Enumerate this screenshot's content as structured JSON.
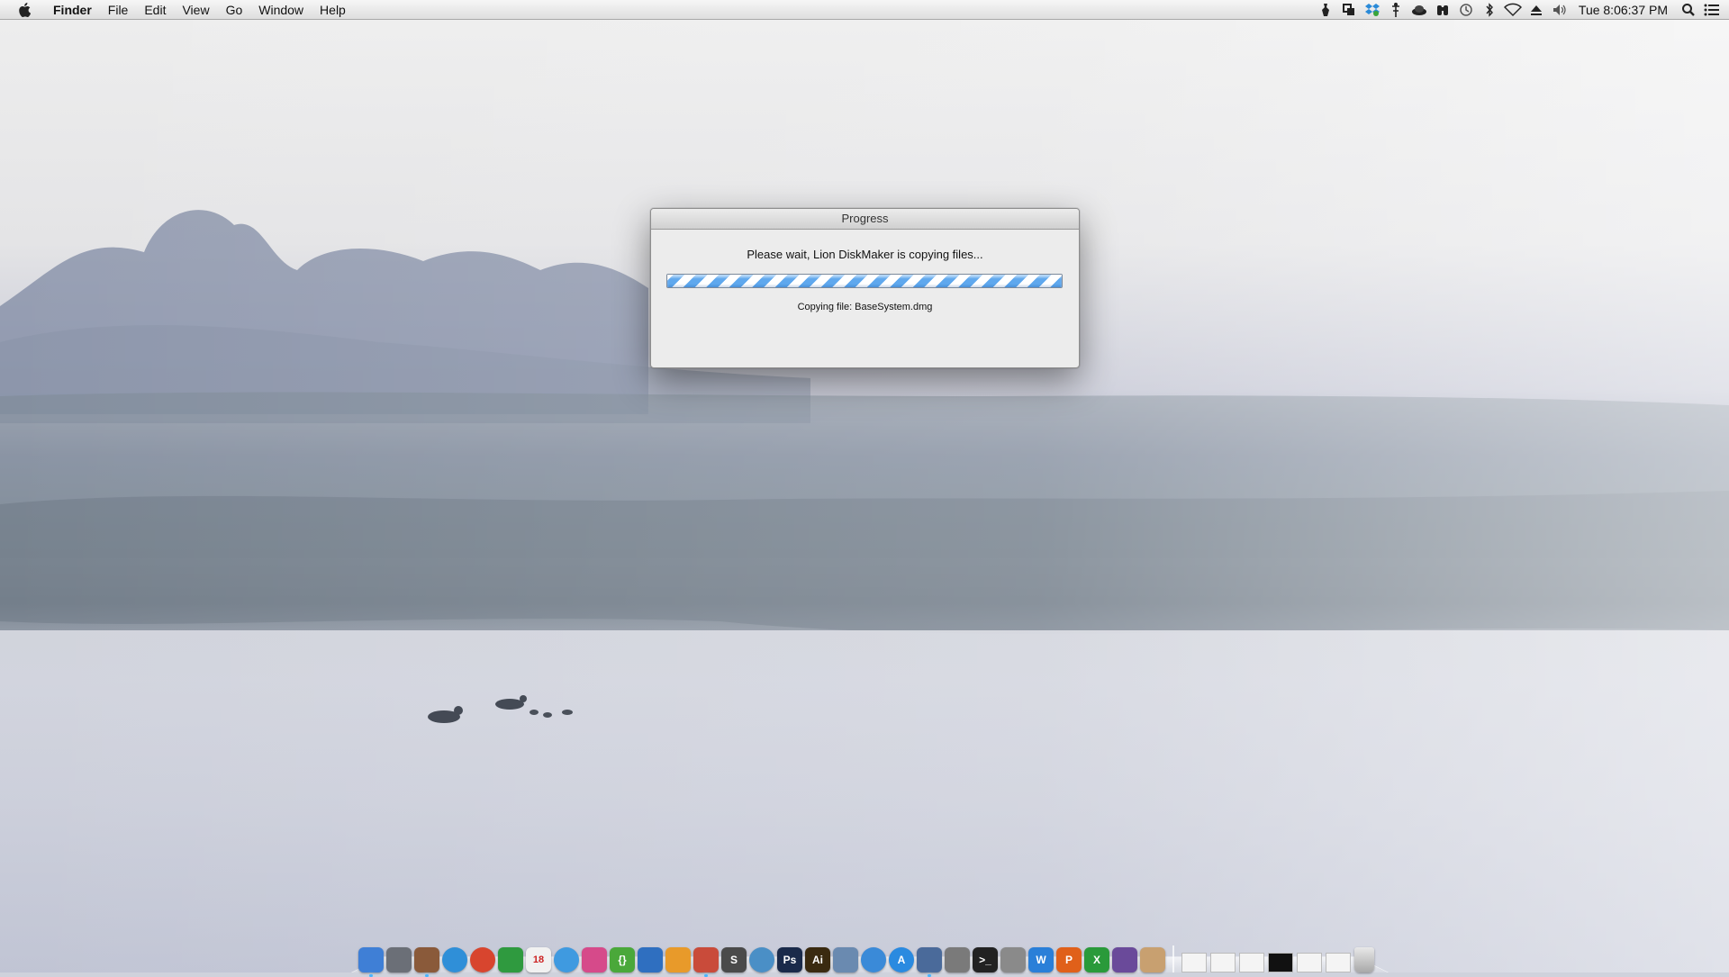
{
  "menubar": {
    "apple_icon": "apple-logo-icon",
    "app_name": "Finder",
    "menus": [
      "File",
      "Edit",
      "View",
      "Go",
      "Window",
      "Help"
    ],
    "status_icons": [
      "alfred-icon",
      "duplicate-icon",
      "dropbox-icon",
      "wheel-icon",
      "hat-icon",
      "binoculars-icon",
      "time-machine-icon",
      "bluetooth-icon",
      "wifi-icon",
      "eject-icon",
      "volume-icon"
    ],
    "clock": "Tue 8:06:37 PM",
    "spotlight_icon": "spotlight-icon",
    "notification_icon": "notification-center-icon"
  },
  "dialog": {
    "title": "Progress",
    "message": "Please wait, Lion DiskMaker is copying files...",
    "progress": 1.0,
    "status": "Copying file: BaseSystem.dmg",
    "accent_color": "#5fa8ee"
  },
  "dock": {
    "apps": [
      {
        "name": "finder",
        "label": "",
        "color": "#3f7fd6",
        "running": true
      },
      {
        "name": "launchpad",
        "label": "",
        "color": "#6b6f77",
        "running": false
      },
      {
        "name": "mission-control",
        "label": "",
        "color": "#8a5a3a",
        "running": true
      },
      {
        "name": "safari",
        "label": "",
        "color": "#2f8fd8",
        "running": false
      },
      {
        "name": "chrome",
        "label": "",
        "color": "#d8452e",
        "running": false
      },
      {
        "name": "evernote",
        "label": "",
        "color": "#2f9a3f",
        "running": false
      },
      {
        "name": "calendar",
        "label": "18",
        "color": "#f1f1f1",
        "running": false
      },
      {
        "name": "messages",
        "label": "",
        "color": "#3f9ae0",
        "running": false
      },
      {
        "name": "pixelmator",
        "label": "",
        "color": "#d64a8a",
        "running": false
      },
      {
        "name": "brackets",
        "label": "{}",
        "color": "#4aa83a",
        "running": false
      },
      {
        "name": "xcode",
        "label": "",
        "color": "#2f6fc0",
        "running": false
      },
      {
        "name": "coda",
        "label": "",
        "color": "#e89a2a",
        "running": false
      },
      {
        "name": "transmit",
        "label": "",
        "color": "#c94b3a",
        "running": true
      },
      {
        "name": "sublime",
        "label": "S",
        "color": "#4a4a4a",
        "running": false
      },
      {
        "name": "network-utility",
        "label": "",
        "color": "#4a8fc6",
        "running": false
      },
      {
        "name": "photoshop",
        "label": "Ps",
        "color": "#1a2a4a",
        "running": false
      },
      {
        "name": "illustrator",
        "label": "Ai",
        "color": "#3a2a10",
        "running": false
      },
      {
        "name": "preview",
        "label": "",
        "color": "#6a8ab0",
        "running": false
      },
      {
        "name": "itunes",
        "label": "",
        "color": "#3a8ad8",
        "running": false
      },
      {
        "name": "app-store",
        "label": "A",
        "color": "#2a8ae0",
        "running": false
      },
      {
        "name": "lion-diskmaker",
        "label": "",
        "color": "#4a6a9a",
        "running": true
      },
      {
        "name": "system-preferences",
        "label": "",
        "color": "#7a7a7a",
        "running": false
      },
      {
        "name": "terminal",
        "label": ">_",
        "color": "#222222",
        "running": false
      },
      {
        "name": "automator",
        "label": "",
        "color": "#8a8a8a",
        "running": false
      },
      {
        "name": "word",
        "label": "W",
        "color": "#2a7fd8",
        "running": false
      },
      {
        "name": "powerpoint",
        "label": "P",
        "color": "#e0601a",
        "running": false
      },
      {
        "name": "excel",
        "label": "X",
        "color": "#2a9a3a",
        "running": false
      },
      {
        "name": "istat-menus",
        "label": "",
        "color": "#6a4a9a",
        "running": false
      },
      {
        "name": "tiger-cat",
        "label": "",
        "color": "#c8a070",
        "running": false
      }
    ],
    "minimized_windows": [
      false,
      false,
      false,
      true,
      false,
      false
    ],
    "trash_icon": "trash-icon"
  }
}
